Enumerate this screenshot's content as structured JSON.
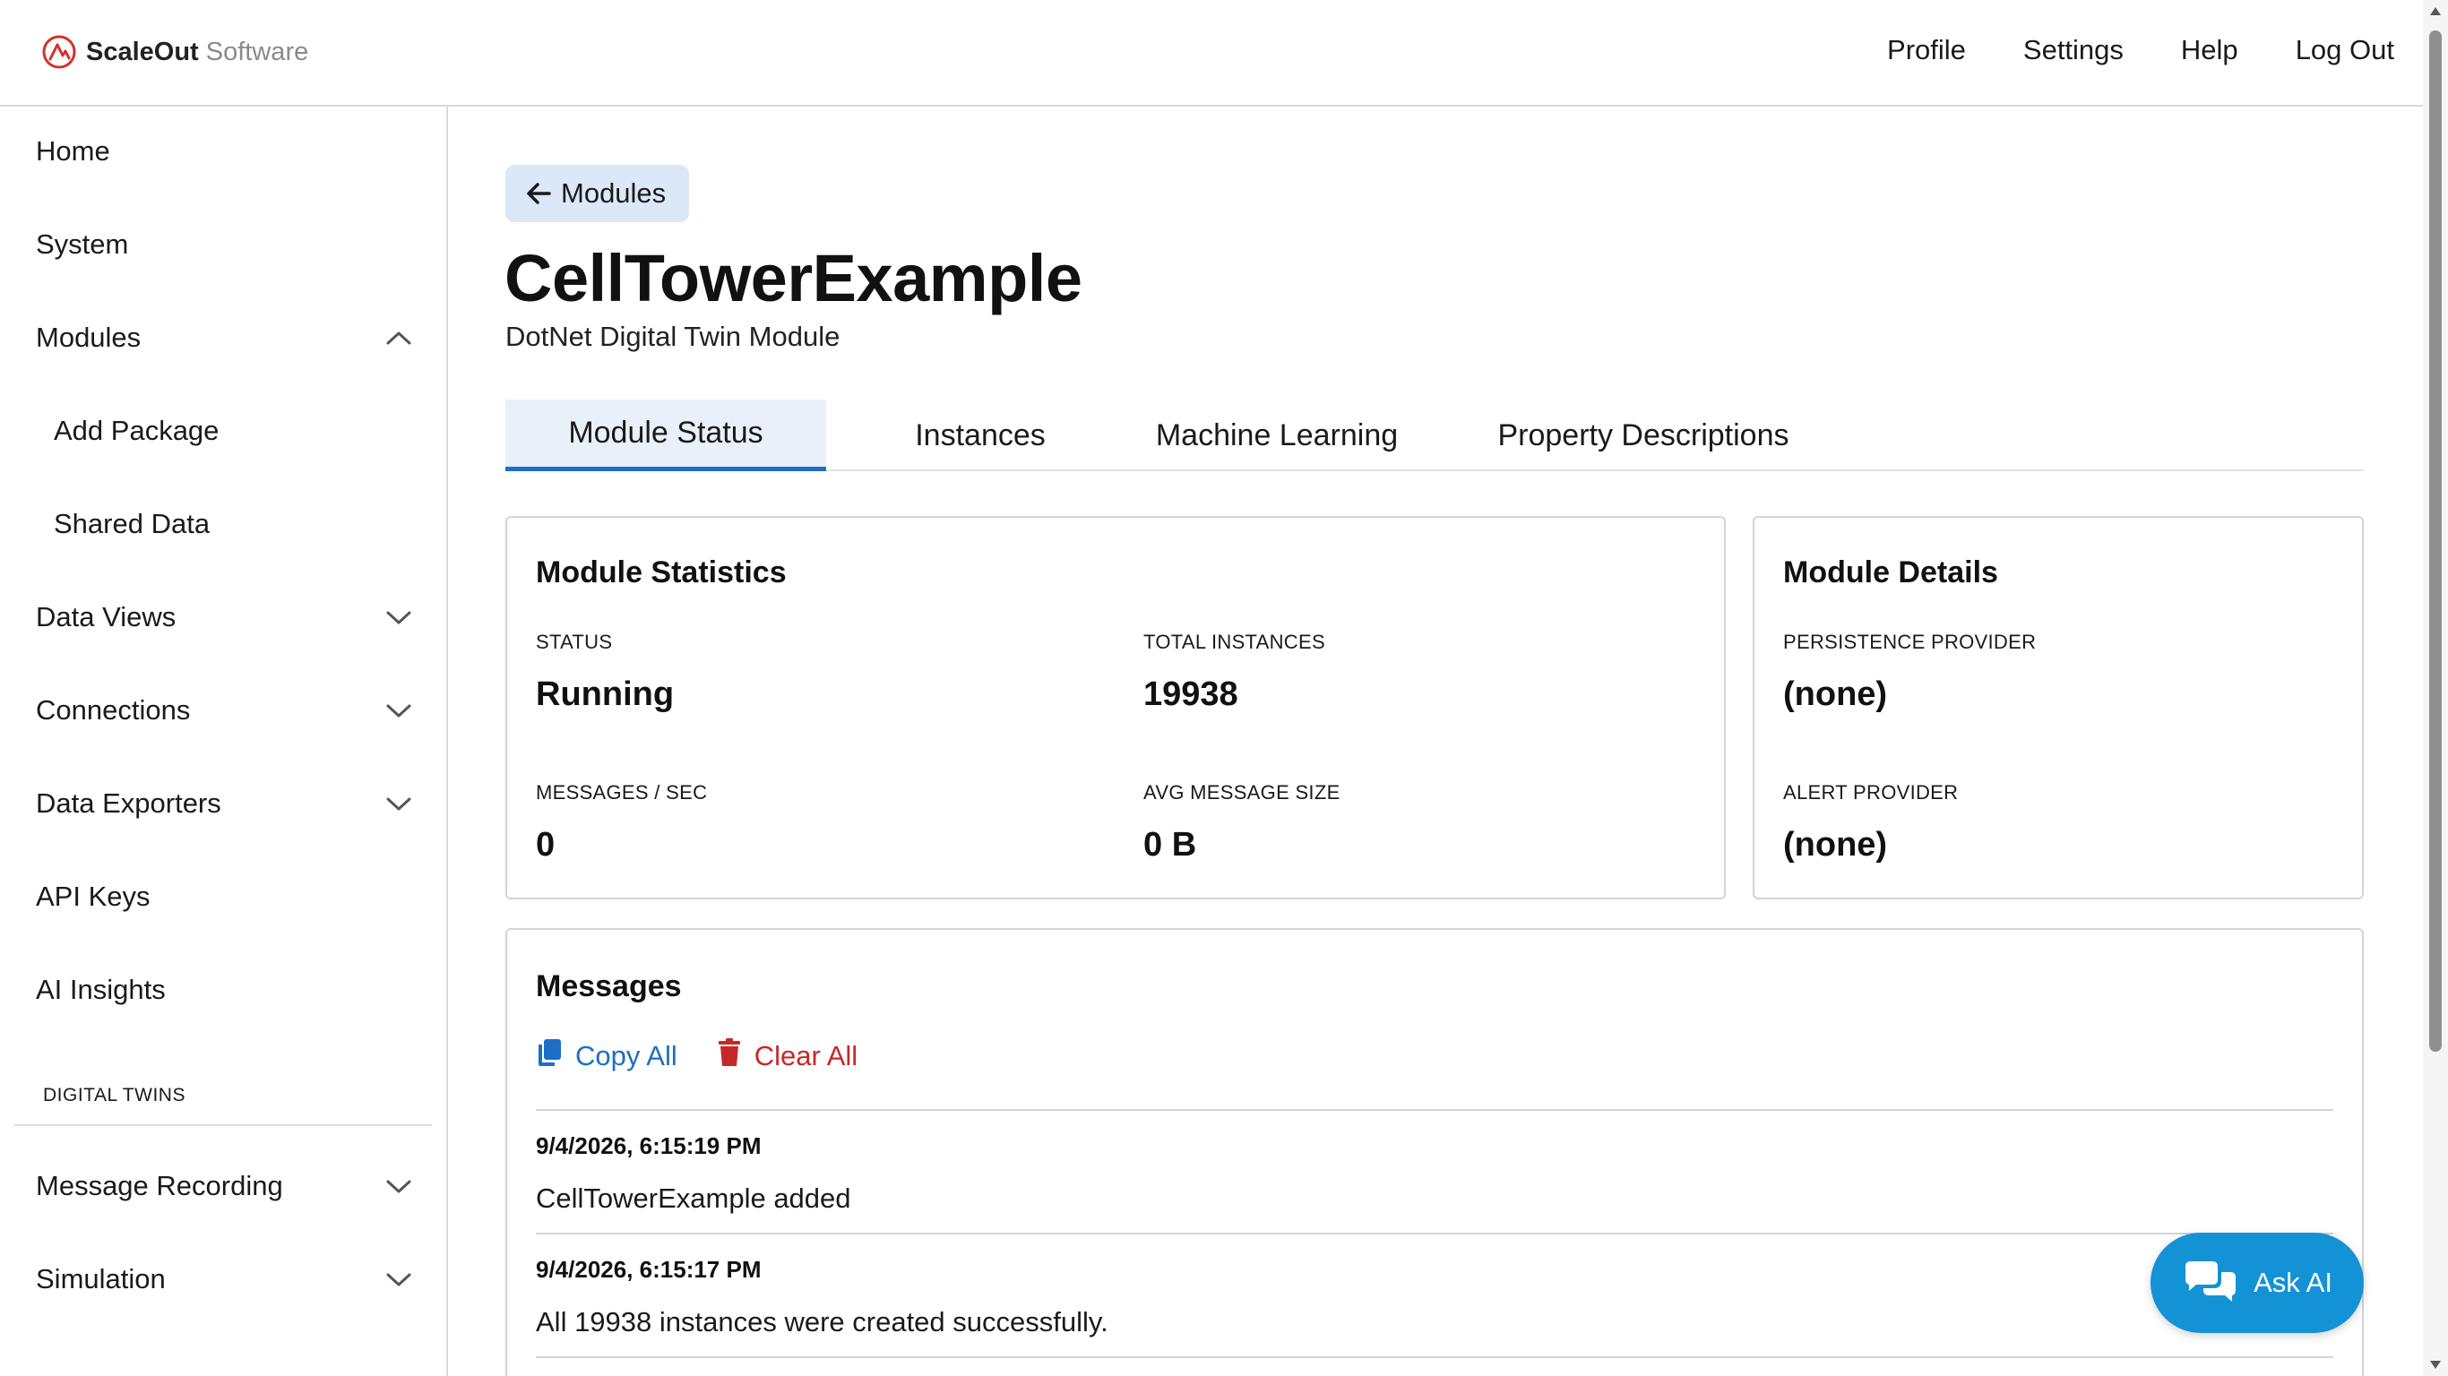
{
  "header": {
    "logo_brand": "ScaleOut",
    "logo_suffix": "Software",
    "logo_icon": "scaleout-logo-icon",
    "nav": [
      {
        "label": "Profile"
      },
      {
        "label": "Settings"
      },
      {
        "label": "Help"
      },
      {
        "label": "Log Out"
      }
    ]
  },
  "sidebar": {
    "items": [
      {
        "label": "Home"
      },
      {
        "label": "System"
      },
      {
        "label": "Modules",
        "icon": "chevron-up-icon",
        "expanded": true
      },
      {
        "label": "Add Package"
      },
      {
        "label": "Shared Data"
      },
      {
        "label": "Data Views",
        "icon": "chevron-down-icon"
      },
      {
        "label": "Connections",
        "icon": "chevron-down-icon"
      },
      {
        "label": "Data Exporters",
        "icon": "chevron-down-icon"
      },
      {
        "label": "API Keys"
      },
      {
        "label": "AI Insights"
      }
    ],
    "section_label": "DIGITAL TWINS",
    "section_items": [
      {
        "label": "Message Recording",
        "icon": "chevron-down-icon"
      },
      {
        "label": "Simulation",
        "icon": "chevron-down-icon"
      }
    ]
  },
  "main": {
    "back_button": "Modules",
    "title": "CellTowerExample",
    "subtitle": "DotNet Digital Twin Module",
    "tabs": [
      {
        "label": "Module Status",
        "active": true
      },
      {
        "label": "Instances"
      },
      {
        "label": "Machine Learning"
      },
      {
        "label": "Property Descriptions"
      }
    ],
    "statistics": {
      "title": "Module Statistics",
      "status_label": "STATUS",
      "status_value": "Running",
      "total_label": "TOTAL INSTANCES",
      "total_value": "19938",
      "rate_label": "MESSAGES / SEC",
      "rate_value": "0",
      "size_label": "AVG MESSAGE SIZE",
      "size_value": "0 B"
    },
    "details": {
      "title": "Module Details",
      "persistence_label": "PERSISTENCE PROVIDER",
      "persistence_value": "(none)",
      "alert_label": "ALERT PROVIDER",
      "alert_value": "(none)"
    },
    "messages": {
      "title": "Messages",
      "copy_label": "Copy All",
      "clear_label": "Clear All",
      "entries": [
        {
          "time": "9/4/2026, 6:15:19 PM",
          "text": "CellTowerExample added"
        },
        {
          "time": "9/4/2026, 6:15:17 PM",
          "text": "All 19938 instances were created successfully."
        }
      ]
    },
    "ask_ai_label": "Ask AI"
  },
  "colors": {
    "accent": "#1b6fc4",
    "back_button_bg": "#dbe8f8",
    "active_tab_bg": "#e9f0f9",
    "clear_red": "#c62828",
    "ask_ai_bg": "#1492d6"
  }
}
